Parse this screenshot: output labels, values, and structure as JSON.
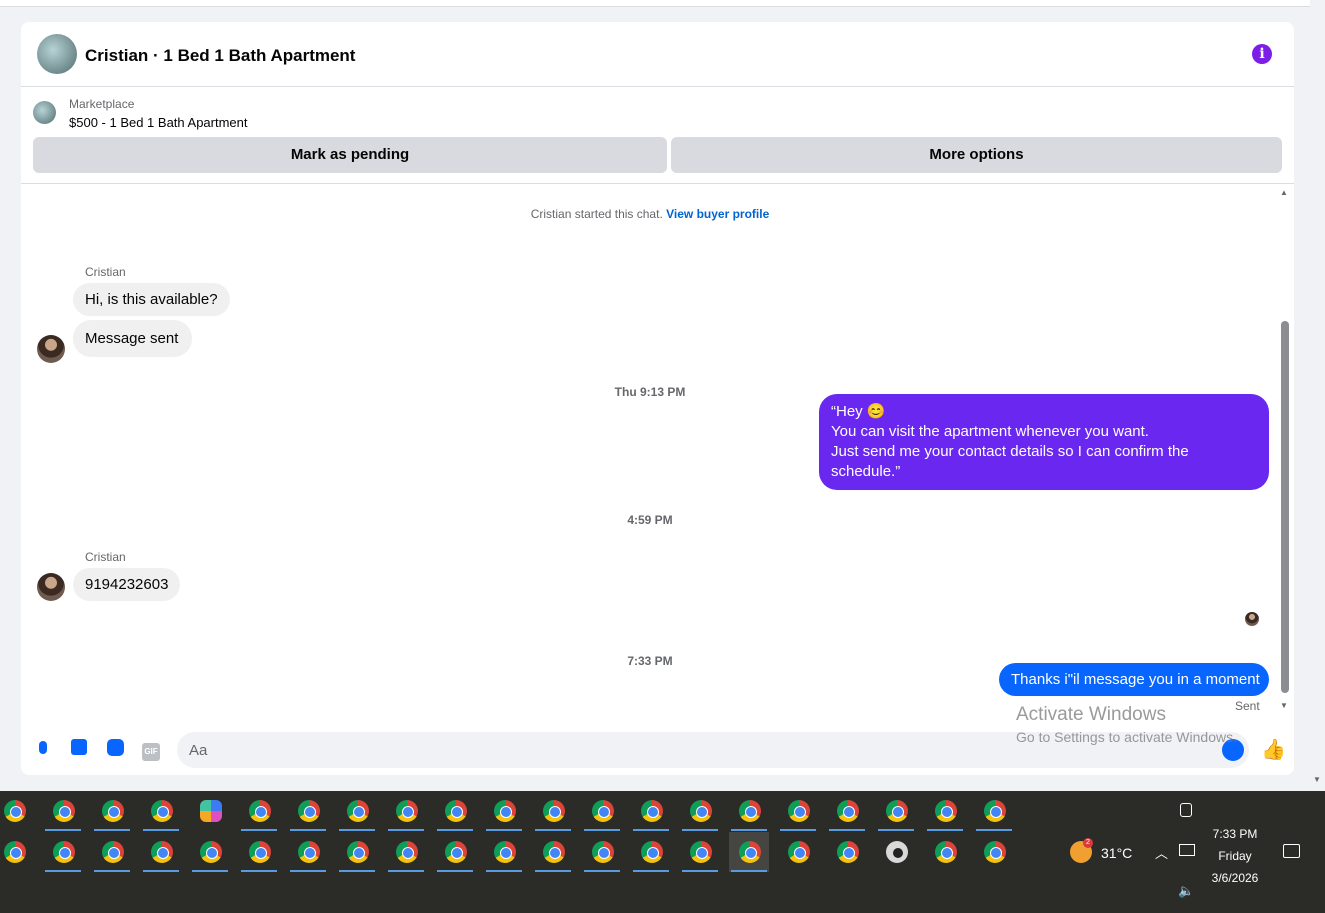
{
  "header": {
    "title": "Cristian · 1 Bed 1 Bath Apartment",
    "info_icon": "info-icon"
  },
  "marketplace": {
    "label": "Marketplace",
    "listing": "$500 - 1 Bed 1 Bath Apartment",
    "pending_label": "Mark as pending",
    "more_label": "More options"
  },
  "chat": {
    "started_text": "Cristian started this chat.",
    "view_profile_link": "View buyer profile",
    "messages": [
      {
        "sender": "Cristian",
        "text": "Hi, is this available?"
      },
      {
        "text": "Message sent"
      },
      {
        "timestamp": "Thu 9:13 PM"
      },
      {
        "outgoing_lines": [
          "“Hey 😊",
          "You can visit the apartment whenever you want.",
          "Just send me your contact details so I can confirm the schedule.”"
        ]
      },
      {
        "timestamp": "4:59 PM"
      },
      {
        "sender": "Cristian",
        "text": "9194232603"
      },
      {
        "timestamp": "7:33 PM"
      },
      {
        "outgoing": "Thanks i\"il message you in a moment",
        "status": "Sent"
      }
    ]
  },
  "composer": {
    "placeholder": "Aa",
    "value": ""
  },
  "watermark": {
    "title": "Activate Windows",
    "subtitle": "Go to Settings to activate Windows."
  },
  "taskbar": {
    "weather_temp": "31°C",
    "weather_badge": "2",
    "time": "7:33 PM",
    "day": "Friday",
    "date": "3/6/2026"
  },
  "colors": {
    "outgoing_purple": "#6a27f0",
    "outgoing_blue": "#0866ff",
    "accent": "#0866ff",
    "info": "#7b1ee8"
  }
}
